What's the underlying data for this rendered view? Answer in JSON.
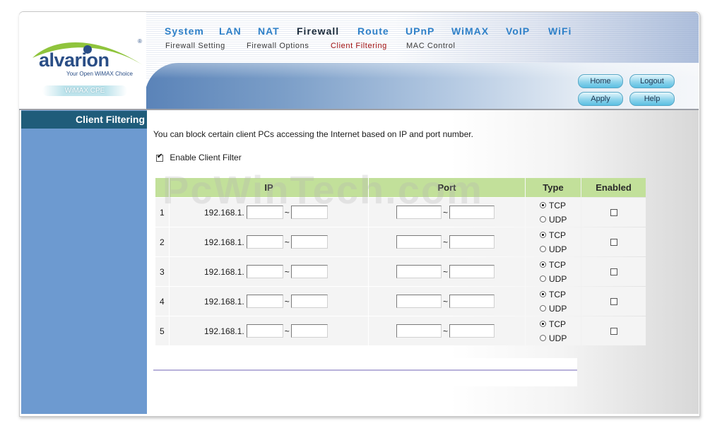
{
  "brand": {
    "logo_text": "alvarion",
    "registered": "®",
    "tagline": "Your Open WiMAX Choice",
    "product": "WiMAX CPE"
  },
  "nav": {
    "main": [
      "System",
      "LAN",
      "NAT",
      "Firewall",
      "Route",
      "UPnP",
      "WiMAX",
      "VoIP",
      "WiFi"
    ],
    "active_main": "Firewall",
    "sub": [
      "Firewall Setting",
      "Firewall Options",
      "Client Filtering",
      "MAC Control"
    ],
    "active_sub": "Client Filtering"
  },
  "buttons": {
    "home": "Home",
    "logout": "Logout",
    "apply": "Apply",
    "help": "Help"
  },
  "sidebar": {
    "title": "Client Filtering"
  },
  "content": {
    "intro": "You can block certain client PCs accessing the Internet based on IP and port number.",
    "enable_label": "Enable Client Filter",
    "enable_checked": true,
    "watermark": "PcWinTech.com"
  },
  "table": {
    "headers": {
      "ip": "IP",
      "port": "Port",
      "type": "Type",
      "enabled": "Enabled"
    },
    "ip_prefix": "192.168.1.",
    "separator": "~",
    "type_options": [
      "TCP",
      "UDP"
    ],
    "rows": [
      {
        "index": "1",
        "type": "TCP",
        "enabled": false
      },
      {
        "index": "2",
        "type": "TCP",
        "enabled": false
      },
      {
        "index": "3",
        "type": "TCP",
        "enabled": false
      },
      {
        "index": "4",
        "type": "TCP",
        "enabled": false
      },
      {
        "index": "5",
        "type": "TCP",
        "enabled": false
      }
    ]
  },
  "colors": {
    "sidebar": "#6d9ad0",
    "sidebar_title": "#1f5c7a",
    "table_header": "#c2e09a",
    "nav_link": "#2e80c8",
    "active_sub": "#a01010"
  }
}
